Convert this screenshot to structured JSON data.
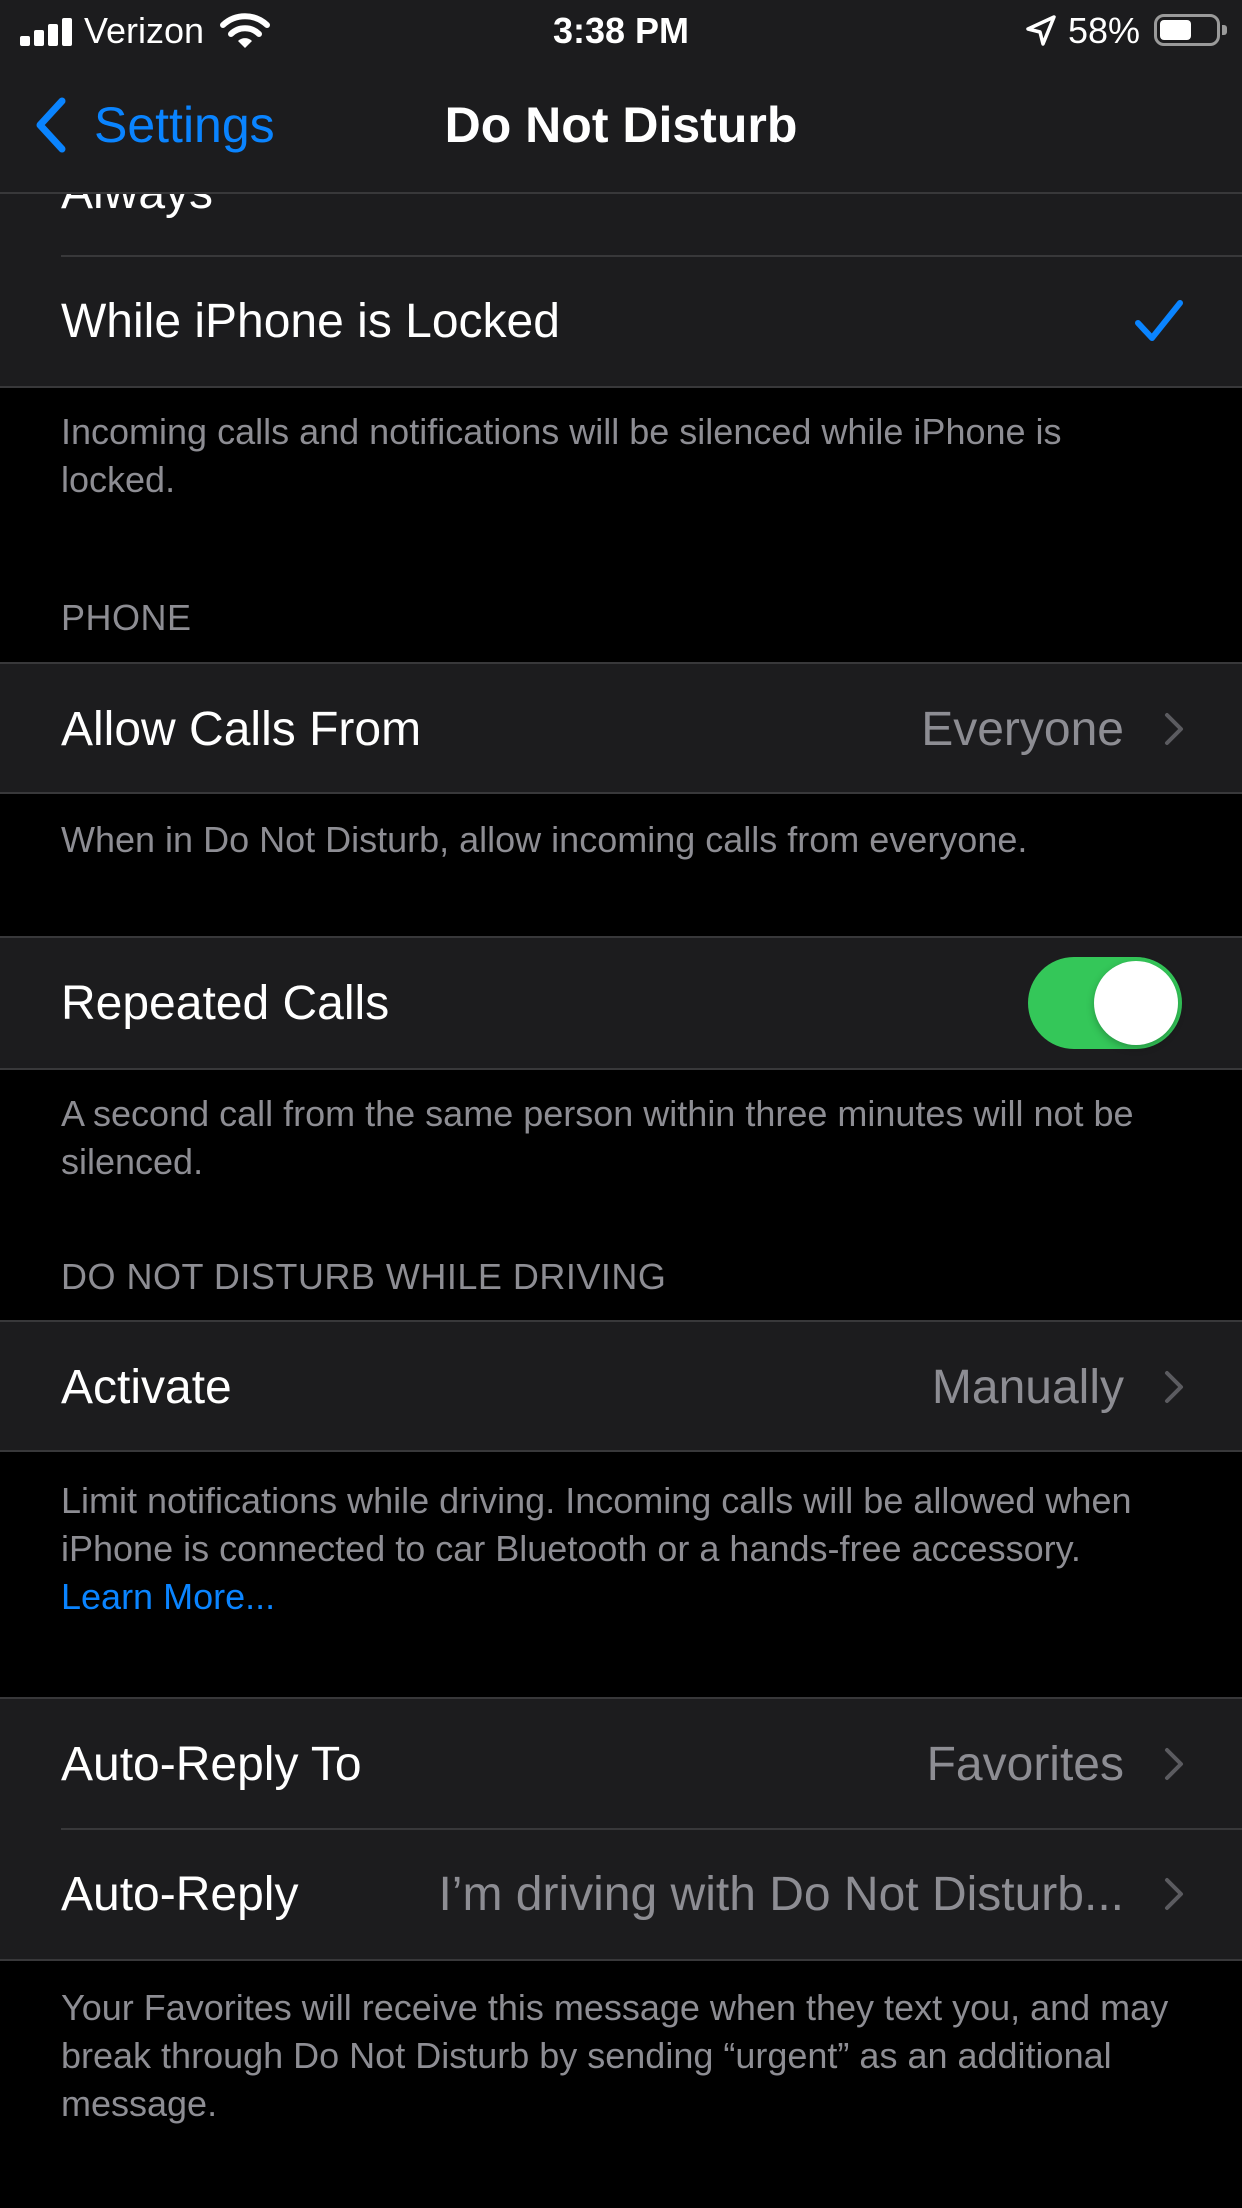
{
  "status_bar": {
    "carrier": "Verizon",
    "time": "3:38 PM",
    "battery_percent": "58%",
    "battery_level": 0.58,
    "icons": [
      "cellular-signal-icon",
      "wifi-icon",
      "location-arrow-icon",
      "battery-icon"
    ]
  },
  "nav": {
    "back_label": "Settings",
    "title": "Do Not Disturb"
  },
  "silence_section": {
    "partial_row_label": "Always",
    "locked_row_label": "While iPhone is Locked",
    "locked_checked": true,
    "footer": "Incoming calls and notifications will be silenced while iPhone is locked."
  },
  "phone_section": {
    "header": "PHONE",
    "allow_calls": {
      "label": "Allow Calls From",
      "value": "Everyone"
    },
    "allow_calls_footer": "When in Do Not Disturb, allow incoming calls from everyone.",
    "repeated_calls": {
      "label": "Repeated Calls",
      "on": true
    },
    "repeated_calls_footer": "A second call from the same person within three minutes will not be silenced."
  },
  "driving_section": {
    "header": "DO NOT DISTURB WHILE DRIVING",
    "activate": {
      "label": "Activate",
      "value": "Manually"
    },
    "footer_text": "Limit notifications while driving. Incoming calls will be allowed when iPhone is connected to car Bluetooth or a hands-free accessory.",
    "footer_link": "Learn More..."
  },
  "auto_reply_section": {
    "auto_reply_to": {
      "label": "Auto-Reply To",
      "value": "Favorites"
    },
    "auto_reply": {
      "label": "Auto-Reply",
      "value": "I’m driving with Do Not Disturb..."
    },
    "footer": "Your Favorites will receive this message when they text you, and may break through Do Not Disturb by sending “urgent” as an additional message."
  },
  "colors": {
    "background": "#000000",
    "cell": "#1c1c1e",
    "separator": "#38383a",
    "accent": "#0a84ff",
    "toggle_on": "#34c759",
    "secondary_text": "#8d8d93"
  }
}
